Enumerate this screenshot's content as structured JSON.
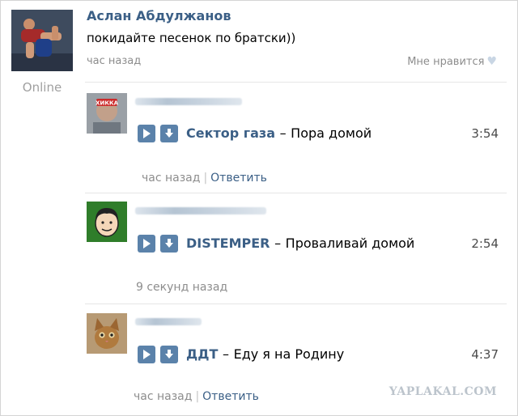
{
  "post": {
    "author": "Аслан Абдулжанов",
    "text": "покидайте песенок по братски))",
    "time": "час назад",
    "like_label": "Мне нравится",
    "status": "Online"
  },
  "comments": [
    {
      "artist": "Сектор газа",
      "separator": "–",
      "title": "Пора домой",
      "duration": "3:54",
      "time": "час назад",
      "pipe": "|",
      "reply_label": "Ответить",
      "avatar_caption": "ХИККА"
    },
    {
      "artist": "DISTEMPER",
      "separator": "–",
      "title": "Проваливай домой",
      "duration": "2:54",
      "time": "9 секунд назад"
    },
    {
      "artist": "ДДТ",
      "separator": "–",
      "title": "Еду я на Родину",
      "duration": "4:37",
      "time": "час назад",
      "pipe": "|",
      "reply_label": "Ответить"
    }
  ],
  "watermark": "YAPLAKAL.COM",
  "colors": {
    "link": "#3b5f86",
    "button": "#5b82aa",
    "muted": "#8d8d8d"
  }
}
